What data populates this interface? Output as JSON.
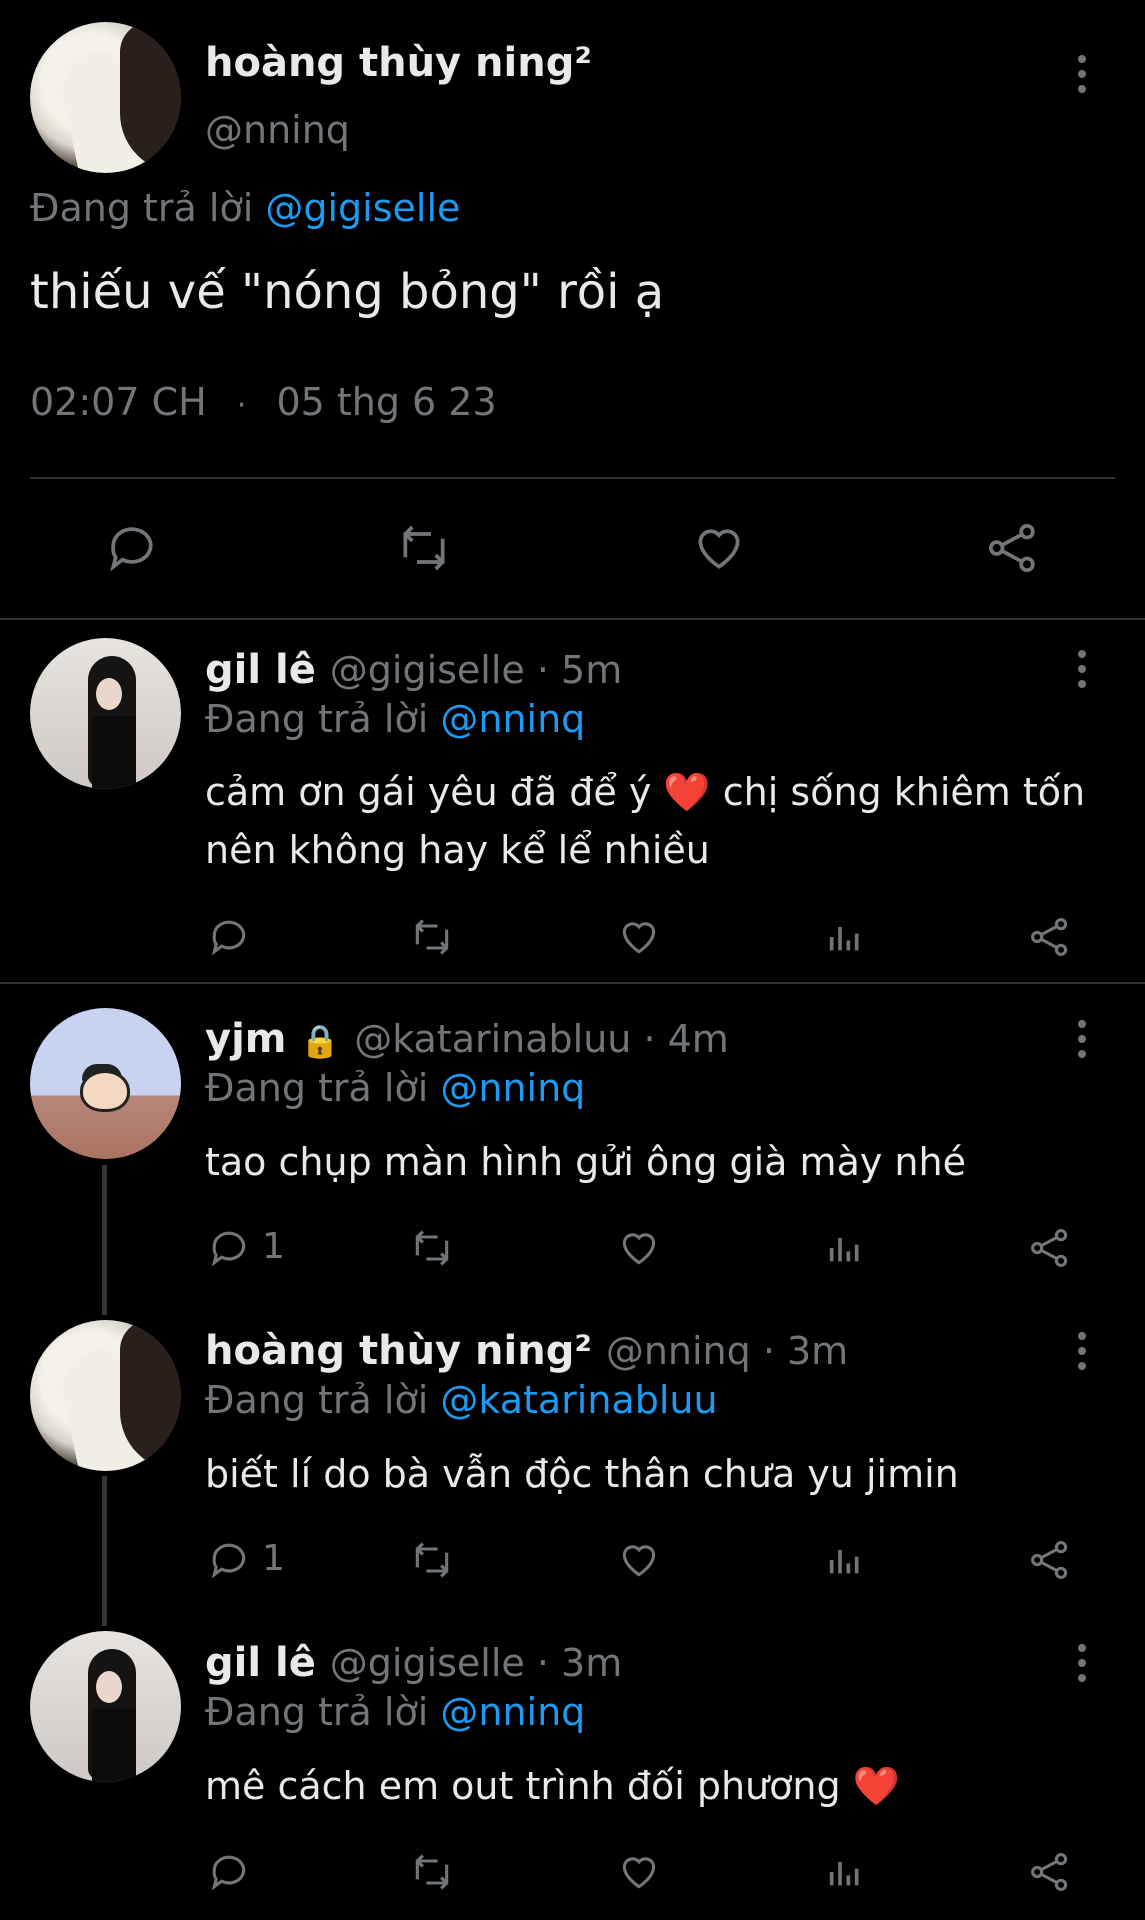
{
  "main_tweet": {
    "name": "hoàng thùy ning²",
    "handle": "@nninq",
    "replying_prefix": "Đang trả lời",
    "replying_to": "@gigiselle",
    "text": "thiếu vế \"nóng bỏng\" rồi ạ",
    "time": "02:07 CH",
    "separator": "·",
    "date": "05 thg 6 23"
  },
  "replies": [
    {
      "name": "gil lê",
      "handle_time": "@gigiselle · 5m",
      "replying_prefix": "Đang trả lời",
      "replying_to": "@nninq",
      "text_line1": "cảm ơn gái yêu đã để ý ❤️ chị sống khiêm tốn",
      "text_line2": "nên không hay kể lể nhiều",
      "reply_count": ""
    },
    {
      "name": "yjm",
      "lock": "🔒",
      "handle_time": "@katarinabluu · 4m",
      "replying_prefix": "Đang trả lời",
      "replying_to": "@nninq",
      "text_line1": "tao chụp màn hình gửi ông già mày nhé",
      "reply_count": "1"
    },
    {
      "name": "hoàng thùy ning²",
      "handle_time": "@nninq · 3m",
      "replying_prefix": "Đang trả lời",
      "replying_to": "@katarinabluu",
      "text_line1": "biết lí do bà vẫn độc thân chưa yu jimin",
      "reply_count": "1"
    },
    {
      "name": "gil lê",
      "handle_time": "@gigiselle · 3m",
      "replying_prefix": "Đang trả lời",
      "replying_to": "@nninq",
      "text_line1": "mê cách em out trình đối phương ❤️",
      "reply_count": ""
    }
  ],
  "colors": {
    "background": "#000000",
    "text": "#e7e9ea",
    "muted": "#71767b",
    "link": "#1d9bf0"
  },
  "icons": [
    "reply-icon",
    "retweet-icon",
    "like-icon",
    "views-icon",
    "share-icon",
    "more-icon",
    "lock-icon"
  ]
}
